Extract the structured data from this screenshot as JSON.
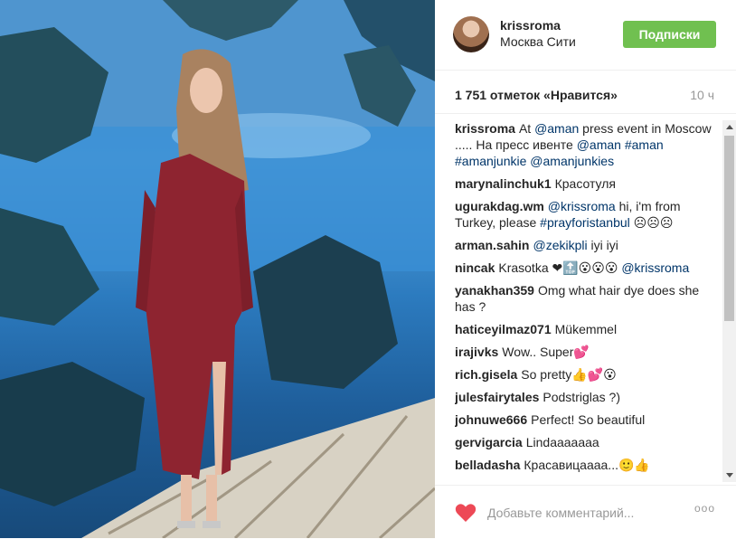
{
  "post": {
    "username": "krissroma",
    "location": "Москва Сити",
    "follow_label": "Подписки",
    "likes": "1 751 отметок «Нравится»",
    "time": "10 ч"
  },
  "comments": [
    {
      "user": "krissroma",
      "parts": [
        "At ",
        "@aman",
        " press event in Moscow ..... На пресс ивенте ",
        "@aman",
        " ",
        "#aman",
        " ",
        "#amanjunkie",
        " ",
        "@amanjunkies"
      ]
    },
    {
      "user": "marynalinchuk1",
      "parts": [
        "Красотуля"
      ]
    },
    {
      "user": "ugurakdag.wm",
      "parts": [
        "@krissroma",
        " hi, i'm from Turkey, please ",
        "#prayforistanbul",
        " ☹☹☹"
      ]
    },
    {
      "user": "arman.sahin",
      "parts": [
        "@zekikpli",
        " iyi iyi"
      ]
    },
    {
      "user": "nincak",
      "parts": [
        "Krasotka ❤🔝😮😮😮 ",
        "@krissroma"
      ]
    },
    {
      "user": "yanakhan359",
      "parts": [
        "Omg what hair dye does she has ?"
      ]
    },
    {
      "user": "haticeyilmaz071",
      "parts": [
        "Mükemmel"
      ]
    },
    {
      "user": "irajivks",
      "parts": [
        "Wow.. Super💕"
      ]
    },
    {
      "user": "rich.gisela",
      "parts": [
        "So pretty👍💕😮"
      ]
    },
    {
      "user": "julesfairytales",
      "parts": [
        "Podstriglas ?)"
      ]
    },
    {
      "user": "johnuwe666",
      "parts": [
        "Perfect! So beautiful"
      ]
    },
    {
      "user": "gervigarcia",
      "parts": [
        "Lindaaaaaaa"
      ]
    },
    {
      "user": "belladasha",
      "parts": [
        "Красавицаааа...🙂👍"
      ]
    }
  ],
  "footer": {
    "comment_placeholder": "Добавьте комментарий...",
    "more_label": "ooo"
  },
  "colors": {
    "follow_button": "#70c050",
    "heart": "#ed4956",
    "link": "#003569"
  },
  "icons": {
    "like": "heart-icon",
    "avatar": "avatar",
    "scroll_up": "triangle-up-icon",
    "scroll_down": "triangle-down-icon"
  }
}
